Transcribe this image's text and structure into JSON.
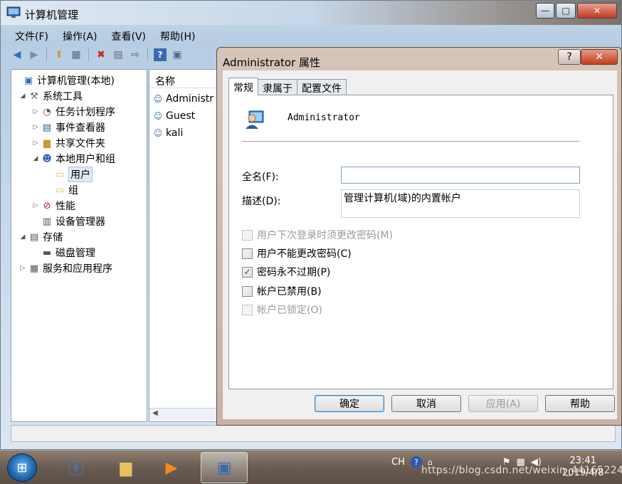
{
  "main_window": {
    "title": "计算机管理",
    "controls": {
      "minimize": "—",
      "maximize": "□",
      "close": "✕"
    },
    "menu": [
      "文件(F)",
      "操作(A)",
      "查看(V)",
      "帮助(H)"
    ],
    "tree": [
      {
        "label": "计算机管理(本地)",
        "icon": "computer-management-icon",
        "glyph": "🖥"
      },
      {
        "label": "系统工具",
        "icon": "tools-icon",
        "glyph": "🛠"
      },
      {
        "label": "任务计划程序",
        "icon": "clock-icon",
        "glyph": "🕓"
      },
      {
        "label": "事件查看器",
        "icon": "event-viewer-icon",
        "glyph": "📋"
      },
      {
        "label": "共享文件夹",
        "icon": "shared-folder-icon",
        "glyph": "📁"
      },
      {
        "label": "本地用户和组",
        "icon": "users-groups-icon",
        "glyph": "👥"
      },
      {
        "label": "用户",
        "icon": "folder-icon",
        "glyph": "📁"
      },
      {
        "label": "组",
        "icon": "folder-icon",
        "glyph": "📁"
      },
      {
        "label": "性能",
        "icon": "performance-icon",
        "glyph": "⛔"
      },
      {
        "label": "设备管理器",
        "icon": "device-manager-icon",
        "glyph": "🖧"
      },
      {
        "label": "存储",
        "icon": "storage-icon",
        "glyph": "🗄"
      },
      {
        "label": "磁盘管理",
        "icon": "disk-icon",
        "glyph": "💽"
      },
      {
        "label": "服务和应用程序",
        "icon": "services-icon",
        "glyph": "⚙"
      }
    ],
    "list": {
      "header": "名称",
      "items": [
        "Administr",
        "Guest",
        "kali"
      ]
    }
  },
  "dialog": {
    "title": "Administrator 属性",
    "help_glyph": "?",
    "close_glyph": "✕",
    "tabs": [
      "常规",
      "隶属于",
      "配置文件"
    ],
    "user_name": "Administrator",
    "fullname_label": "全名(F):",
    "fullname_value": "",
    "description_label": "描述(D):",
    "description_value": "管理计算机(域)的内置帐户",
    "checkboxes": [
      {
        "label": "用户下次登录时须更改密码(M)",
        "checked": false,
        "disabled": true
      },
      {
        "label": "用户不能更改密码(C)",
        "checked": false,
        "disabled": false
      },
      {
        "label": "密码永不过期(P)",
        "checked": true,
        "disabled": false
      },
      {
        "label": "帐户已禁用(B)",
        "checked": false,
        "disabled": false
      },
      {
        "label": "帐户已锁定(O)",
        "checked": false,
        "disabled": true
      }
    ],
    "buttons": {
      "ok": "确定",
      "cancel": "取消",
      "apply": "应用(A)",
      "help": "帮助"
    },
    "check_glyph": "✓"
  },
  "taskbar": {
    "ime": "CH",
    "time": "23:41",
    "date": "2019/4/8",
    "watermark": "https://blog.csdn.net/weixin_44165224"
  }
}
